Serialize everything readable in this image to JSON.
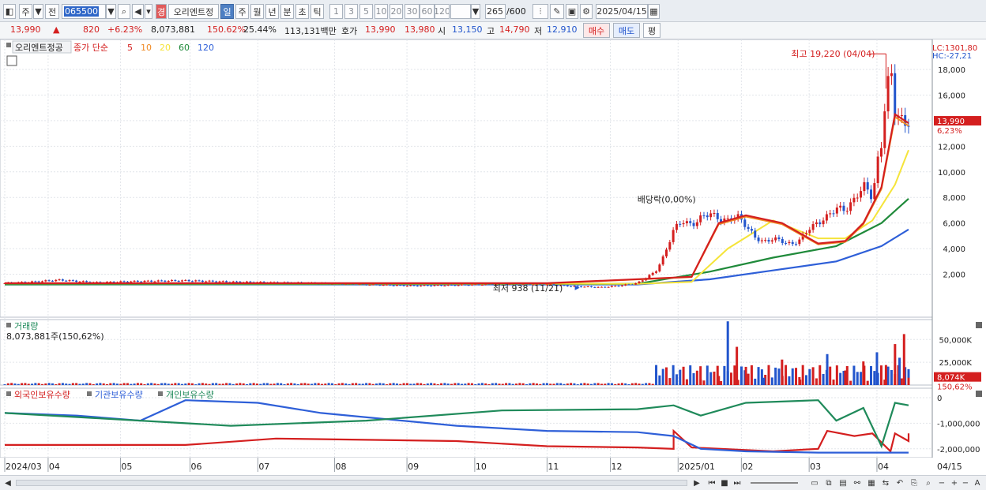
{
  "toolbar": {
    "market": "주",
    "prev": "전",
    "code": "065500",
    "stock_name": "오리엔트정",
    "period_tabs": [
      "일",
      "주",
      "월",
      "년",
      "분",
      "초",
      "틱"
    ],
    "intervals": [
      "1",
      "3",
      "5",
      "10",
      "20",
      "30",
      "60",
      "120"
    ],
    "count": "265",
    "count_max": "/600",
    "date": "2025/04/15",
    "icons": [
      "layout-icon",
      "search-icon",
      "speaker-icon",
      "warning-icon",
      "candle-settings-icon",
      "draw-icon",
      "save-icon",
      "gear-icon",
      "calendar-icon"
    ]
  },
  "quote": {
    "price": "13,990",
    "change_arrow": "▲",
    "change": "820",
    "change_pct": "+6.23%",
    "volume": "8,073,881",
    "volume_ratio": "150.62%",
    "turnover": "25.44%",
    "amount": "113,131백만",
    "ask_label": "호가",
    "ask": "13,990",
    "bid": "13,980",
    "open_label": "시",
    "open": "13,150",
    "high_label": "고",
    "high": "14,790",
    "low_label": "저",
    "low": "12,910",
    "buy_label": "매수",
    "sell_label": "매도",
    "avg_label": "평"
  },
  "price_panel": {
    "stock_title": "오리엔트정공",
    "ma_title": "종가 단순",
    "ma_periods": [
      "5",
      "10",
      "20",
      "60",
      "120"
    ],
    "lc": "LC:1301,80",
    "hc": "HC:-27,21",
    "high_annotation": "최고 19,220 (04/04)",
    "low_annotation": "최저 938 (11/21)",
    "event_annotation": "배당락(0,00%)",
    "current_label": "13,990",
    "current_pct": "6,23%",
    "y_ticks": [
      "18,000",
      "16,000",
      "14,000",
      "12,000",
      "10,000",
      "8,000",
      "6,000",
      "4,000",
      "2,000"
    ]
  },
  "volume_panel": {
    "title": "거래량",
    "value": "8,073,881주(150,62%)",
    "y_ticks": [
      "50,000K",
      "25,000K"
    ],
    "current_label": "8,074K",
    "current_pct": "150,62%"
  },
  "holder_panel": {
    "legends": [
      "외국인보유수량",
      "기관보유수량",
      "개인보유수량"
    ],
    "y_ticks": [
      "0",
      "-1,000,000",
      "-2,000,000"
    ]
  },
  "x_axis": {
    "labels": [
      "2024/03",
      "04",
      "05",
      "06",
      "07",
      "08",
      "09",
      "10",
      "11",
      "12",
      "2025/01",
      "02",
      "03",
      "04"
    ],
    "right_label": "04/15"
  },
  "statusbar": {
    "zoom_label": "A"
  },
  "colors": {
    "up": "#d41f1f",
    "down": "#2255cc",
    "ma5": "#d41f1f",
    "ma10": "#f08a24",
    "ma20": "#f5e43a",
    "ma60": "#1f8a3a",
    "ma120": "#2e5fd8",
    "foreign": "#d41f1f",
    "institution": "#2e5fd8",
    "individual": "#1f8a5a"
  },
  "chart_data": [
    {
      "type": "candlestick",
      "title": "오리엔트정공",
      "x": [
        "2024/03",
        "2024/04",
        "2024/05",
        "2024/06",
        "2024/07",
        "2024/08",
        "2024/09",
        "2024/10",
        "2024/11",
        "2024/12",
        "2025/01",
        "2025/02",
        "2025/03",
        "2025/04"
      ],
      "ylim": [
        0,
        19500
      ],
      "points": [
        [
          "2024/03",
          1300
        ],
        [
          "2024/04",
          1500
        ],
        [
          "2024/05",
          1400
        ],
        [
          "2024/06",
          1450
        ],
        [
          "2024/07",
          1350
        ],
        [
          "2024/08",
          1150
        ],
        [
          "2024/09",
          1100
        ],
        [
          "2024/10",
          1250
        ],
        [
          "2024/11",
          1100
        ],
        [
          "2024/11/21",
          938
        ],
        [
          "2024/12/01",
          1300
        ],
        [
          "2024/12/10",
          6000
        ],
        [
          "2024/12/20",
          6500
        ],
        [
          "2025/01/01",
          6300
        ],
        [
          "2025/01/10",
          4500
        ],
        [
          "2025/02/01",
          4300
        ],
        [
          "2025/02/15",
          6000
        ],
        [
          "2025/03/01",
          7000
        ],
        [
          "2025/03/20",
          8500
        ],
        [
          "2025/04/04",
          19220
        ],
        [
          "2025/04/10",
          14000
        ],
        [
          "2025/04/15",
          13990
        ]
      ],
      "ma": {
        "5": [
          [
            0,
            1300
          ],
          [
            0.6,
            1300
          ],
          [
            0.76,
            1800
          ],
          [
            0.79,
            6000
          ],
          [
            0.82,
            6600
          ],
          [
            0.86,
            6000
          ],
          [
            0.9,
            4400
          ],
          [
            0.93,
            4600
          ],
          [
            0.95,
            6000
          ],
          [
            0.97,
            8800
          ],
          [
            0.985,
            14500
          ],
          [
            1,
            13800
          ]
        ],
        "20": [
          [
            0,
            1300
          ],
          [
            0.7,
            1250
          ],
          [
            0.76,
            1400
          ],
          [
            0.8,
            4000
          ],
          [
            0.85,
            6200
          ],
          [
            0.9,
            4800
          ],
          [
            0.93,
            4800
          ],
          [
            0.96,
            6200
          ],
          [
            0.985,
            9000
          ],
          [
            1,
            11700
          ]
        ],
        "60": [
          [
            0,
            1200
          ],
          [
            0.7,
            1250
          ],
          [
            0.78,
            2200
          ],
          [
            0.85,
            3300
          ],
          [
            0.92,
            4200
          ],
          [
            0.97,
            6000
          ],
          [
            1,
            7900
          ]
        ],
        "120": [
          [
            0,
            1200
          ],
          [
            0.7,
            1200
          ],
          [
            0.78,
            1600
          ],
          [
            0.85,
            2300
          ],
          [
            0.92,
            3000
          ],
          [
            0.97,
            4200
          ],
          [
            1,
            5500
          ]
        ]
      }
    },
    {
      "type": "bar",
      "title": "거래량",
      "bars": [
        [
          0.77,
          6000
        ],
        [
          0.79,
          10000
        ],
        [
          0.8,
          70000
        ],
        [
          0.81,
          42000
        ],
        [
          0.82,
          20000
        ],
        [
          0.84,
          8000
        ],
        [
          0.86,
          28000
        ],
        [
          0.88,
          6000
        ],
        [
          0.91,
          34000
        ],
        [
          0.93,
          16000
        ],
        [
          0.95,
          26000
        ],
        [
          0.965,
          36000
        ],
        [
          0.975,
          22000
        ],
        [
          0.985,
          45000
        ],
        [
          0.99,
          30000
        ],
        [
          0.995,
          56000
        ],
        [
          1,
          8074
        ]
      ]
    },
    {
      "type": "line",
      "title": "보유수량",
      "ylim": [
        -2200000,
        300000
      ],
      "series": [
        {
          "name": "외국인보유수량",
          "values": [
            [
              0,
              -1850000
            ],
            [
              0.2,
              -1850000
            ],
            [
              0.3,
              -1600000
            ],
            [
              0.5,
              -1700000
            ],
            [
              0.6,
              -1900000
            ],
            [
              0.7,
              -1950000
            ],
            [
              0.74,
              -2000000
            ],
            [
              0.74,
              -1300000
            ],
            [
              0.76,
              -1950000
            ],
            [
              0.85,
              -2100000
            ],
            [
              0.9,
              -2000000
            ],
            [
              0.91,
              -1300000
            ],
            [
              0.94,
              -1500000
            ],
            [
              0.96,
              -1400000
            ],
            [
              0.98,
              -2100000
            ],
            [
              0.985,
              -1400000
            ],
            [
              1,
              -1700000
            ],
            [
              1.01,
              -1400000
            ]
          ]
        },
        {
          "name": "기관보유수량",
          "values": [
            [
              0,
              -600000
            ],
            [
              0.08,
              -700000
            ],
            [
              0.15,
              -900000
            ],
            [
              0.2,
              -100000
            ],
            [
              0.28,
              -200000
            ],
            [
              0.35,
              -600000
            ],
            [
              0.5,
              -1100000
            ],
            [
              0.6,
              -1300000
            ],
            [
              0.7,
              -1350000
            ],
            [
              0.74,
              -1500000
            ],
            [
              0.77,
              -2000000
            ],
            [
              0.82,
              -2100000
            ],
            [
              0.9,
              -2150000
            ],
            [
              1,
              -2150000
            ]
          ]
        },
        {
          "name": "개인보유수량",
          "values": [
            [
              0,
              -600000
            ],
            [
              0.1,
              -800000
            ],
            [
              0.25,
              -1100000
            ],
            [
              0.4,
              -900000
            ],
            [
              0.55,
              -500000
            ],
            [
              0.7,
              -450000
            ],
            [
              0.74,
              -300000
            ],
            [
              0.77,
              -700000
            ],
            [
              0.82,
              -200000
            ],
            [
              0.9,
              -100000
            ],
            [
              0.92,
              -900000
            ],
            [
              0.95,
              -400000
            ],
            [
              0.97,
              -1900000
            ],
            [
              0.985,
              -200000
            ],
            [
              1,
              -300000
            ]
          ]
        }
      ]
    }
  ]
}
